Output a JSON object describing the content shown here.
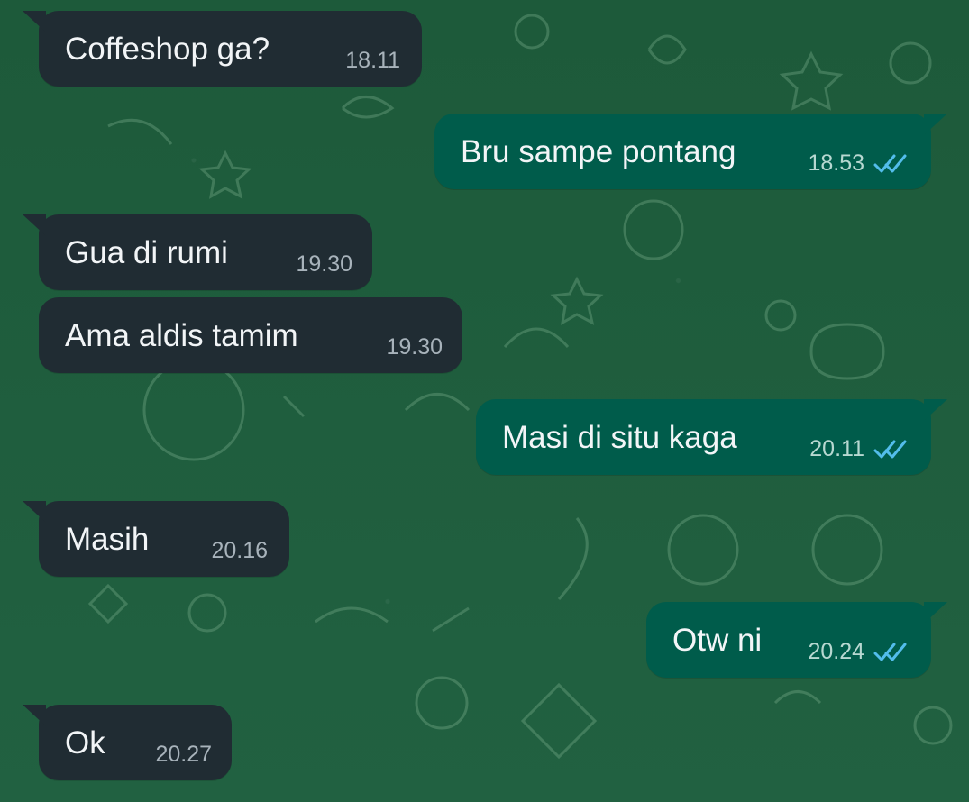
{
  "messages": [
    {
      "direction": "incoming",
      "text": "Coffeshop ga?",
      "time": "18.11"
    },
    {
      "direction": "outgoing",
      "text": "Bru sampe pontang",
      "time": "18.53",
      "status_icon": "double-check-read-icon"
    },
    {
      "direction": "incoming",
      "text": "Gua di rumi",
      "time": "19.30"
    },
    {
      "direction": "incoming",
      "text": "Ama aldis tamim",
      "time": "19.30"
    },
    {
      "direction": "outgoing",
      "text": "Masi di situ kaga",
      "time": "20.11",
      "status_icon": "double-check-read-icon"
    },
    {
      "direction": "incoming",
      "text": "Masih",
      "time": "20.16"
    },
    {
      "direction": "outgoing",
      "text": "Otw ni",
      "time": "20.24",
      "status_icon": "double-check-read-icon"
    },
    {
      "direction": "incoming",
      "text": "Ok",
      "time": "20.27"
    }
  ],
  "colors": {
    "background": "#1f5a3b",
    "incoming_bubble": "#202c33",
    "outgoing_bubble": "#005c4b",
    "read_check": "#53bdeb"
  }
}
